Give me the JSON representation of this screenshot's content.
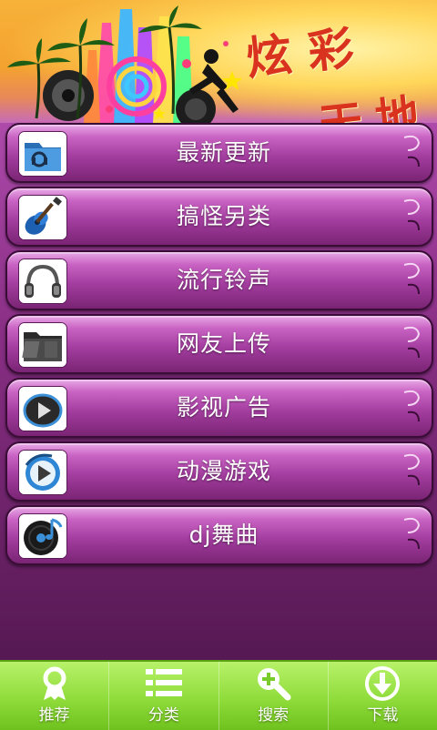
{
  "banner": {
    "title_top": "炫彩",
    "title_bottom": "天地"
  },
  "menu": {
    "items": [
      {
        "label": "最新更新",
        "icon": "folder-blue-icon"
      },
      {
        "label": "搞怪另类",
        "icon": "guitar-icon"
      },
      {
        "label": "流行铃声",
        "icon": "headphones-icon"
      },
      {
        "label": "网友上传",
        "icon": "folder-dark-icon"
      },
      {
        "label": "影视广告",
        "icon": "play-icon"
      },
      {
        "label": "动漫游戏",
        "icon": "media-player-icon"
      },
      {
        "label": "dj舞曲",
        "icon": "music-disc-icon"
      }
    ]
  },
  "tabs": [
    {
      "label": "推荐",
      "icon": "ribbon-icon"
    },
    {
      "label": "分类",
      "icon": "list-icon"
    },
    {
      "label": "搜索",
      "icon": "search-plus-icon"
    },
    {
      "label": "下载",
      "icon": "download-icon"
    }
  ]
}
